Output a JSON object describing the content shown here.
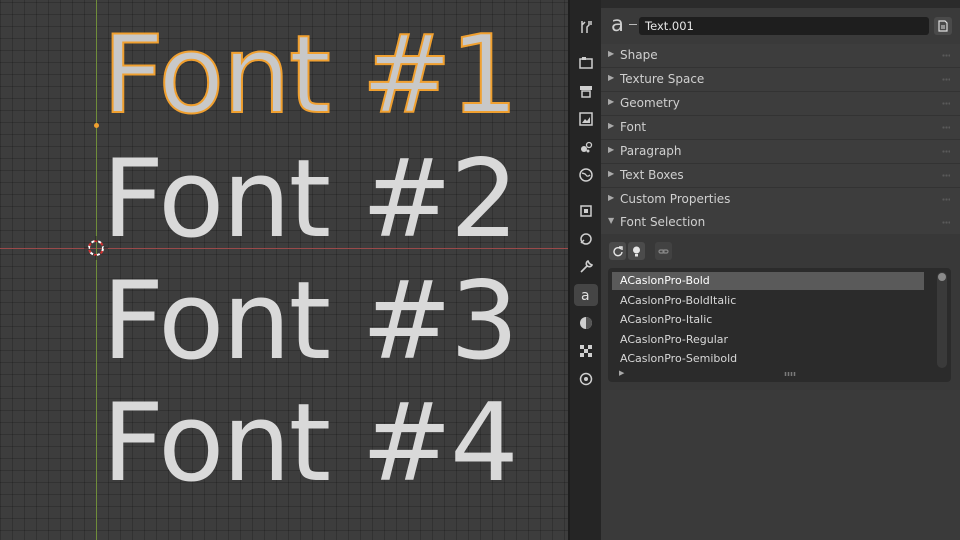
{
  "viewport": {
    "texts": [
      "Font #1",
      "Font #2",
      "Font #3",
      "Font #4"
    ]
  },
  "properties": {
    "tabs": [
      "tool-icon",
      "render-icon",
      "output-icon",
      "view-layer-icon",
      "scene-icon",
      "world-icon",
      "object-icon",
      "modifier-icon",
      "wrench-icon",
      "data-text-icon",
      "material-icon",
      "texture-icon",
      "particles-icon"
    ],
    "header": {
      "icon": "a",
      "name": "Text.001"
    },
    "sections": [
      {
        "label": "Shape",
        "expanded": false
      },
      {
        "label": "Texture Space",
        "expanded": false
      },
      {
        "label": "Geometry",
        "expanded": false
      },
      {
        "label": "Font",
        "expanded": false
      },
      {
        "label": "Paragraph",
        "expanded": false
      },
      {
        "label": "Text Boxes",
        "expanded": false
      },
      {
        "label": "Custom Properties",
        "expanded": false
      },
      {
        "label": "Font Selection",
        "expanded": true
      }
    ],
    "font_selection": {
      "items": [
        "ACaslonPro-Bold",
        "ACaslonPro-BoldItalic",
        "ACaslonPro-Italic",
        "ACaslonPro-Regular",
        "ACaslonPro-Semibold"
      ],
      "selected_index": 0
    },
    "colors": {
      "selection_outline": "#f0a030",
      "accent_red_axis": "#9a4a4a",
      "accent_green_axis": "#6f8d3a"
    }
  }
}
